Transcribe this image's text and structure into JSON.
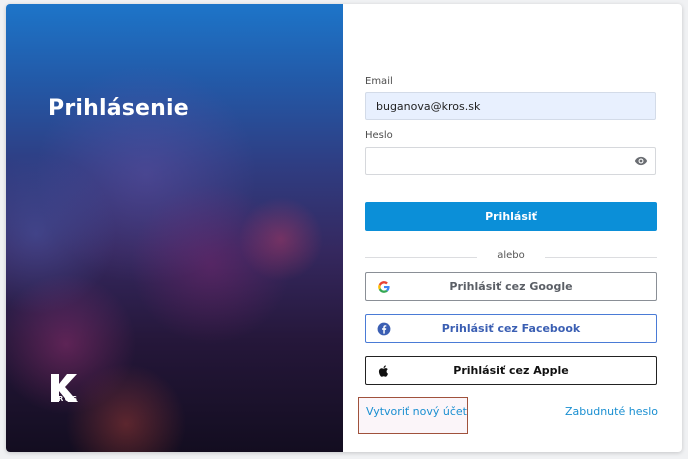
{
  "hero": {
    "title": "Prihlásenie",
    "logo_text": "KROS"
  },
  "form": {
    "email_label": "Email",
    "email_value": "buganova@kros.sk",
    "password_label": "Heslo",
    "password_value": "",
    "login_button": "Prihlásiť",
    "divider_text": "alebo",
    "google_button": "Prihlásiť cez Google",
    "facebook_button": "Prihlásiť cez Facebook",
    "apple_button": "Prihlásiť cez Apple",
    "create_account_link": "Vytvoriť nový účet",
    "forgot_password_link": "Zabudnuté heslo"
  },
  "colors": {
    "primary": "#0b8fd8",
    "link": "#1a8fd1",
    "facebook": "#3b5fb3"
  },
  "icons": {
    "password_toggle": "eye-icon",
    "google": "google-icon",
    "facebook": "facebook-icon",
    "apple": "apple-icon"
  }
}
